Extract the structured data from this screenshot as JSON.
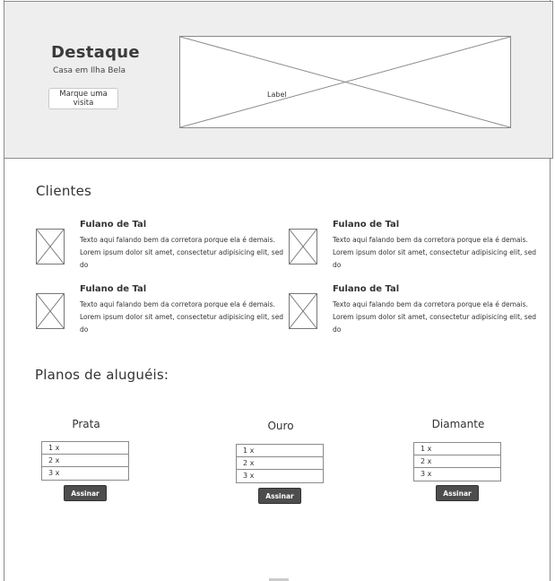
{
  "hero": {
    "title": "Destaque",
    "subtitle": "Casa em Ilha Bela",
    "button_label": "Marque uma visita",
    "image_label": "Label"
  },
  "clients": {
    "title": "Clientes",
    "items": [
      {
        "name": "Fulano de Tal",
        "text": "Texto aqui falando bem da corretora porque ela é demais. Lorem ipsum dolor sit amet, consectetur adipisicing elit, sed do"
      },
      {
        "name": "Fulano de Tal",
        "text": "Texto aqui falando bem da corretora porque ela é demais. Lorem ipsum dolor sit amet, consectetur adipisicing elit, sed do"
      },
      {
        "name": "Fulano de Tal",
        "text": "Texto aqui falando bem da corretora porque ela é demais. Lorem ipsum dolor sit amet, consectetur adipisicing elit, sed do"
      },
      {
        "name": "Fulano de Tal",
        "text": "Texto aqui falando bem da corretora porque ela é demais. Lorem ipsum dolor sit amet, consectetur adipisicing elit, sed do"
      }
    ]
  },
  "plans": {
    "title": "Planos de aluguéis:",
    "button_label": "Assinar",
    "items": [
      {
        "name": "Prata",
        "options": [
          "1 x",
          "2 x",
          "3 x"
        ]
      },
      {
        "name": "Ouro",
        "options": [
          "1 x",
          "2 x",
          "3 x"
        ]
      },
      {
        "name": "Diamante",
        "options": [
          "1 x",
          "2 x",
          "3 x"
        ]
      }
    ]
  },
  "colors": {
    "hero_background": "#eeeeee",
    "button_dark": "#4d4d4d",
    "border": "#8a8a8a"
  }
}
